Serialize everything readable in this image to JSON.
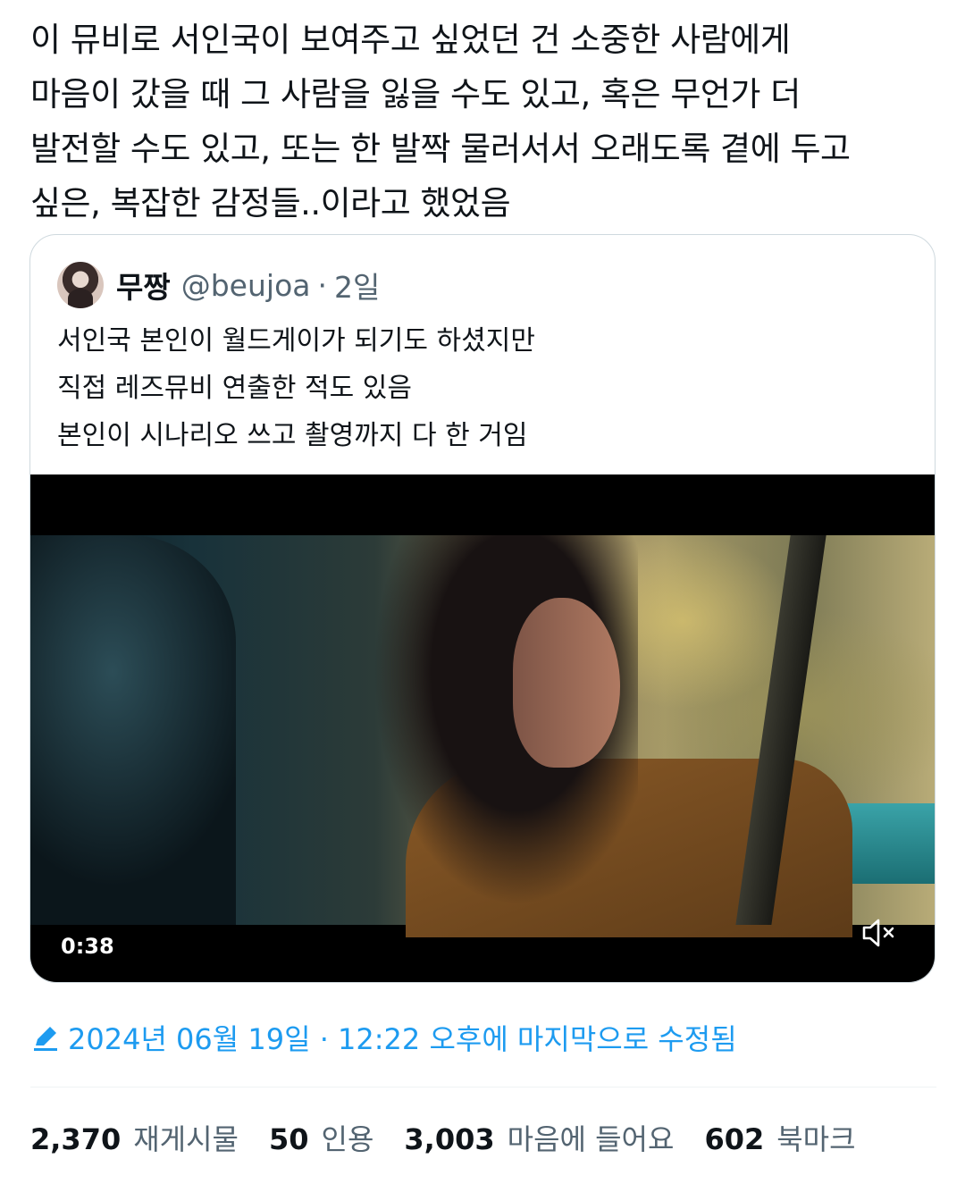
{
  "tweet": {
    "text_lines": [
      "이 뮤비로 서인국이 보여주고 싶었던 건 소중한 사람에게",
      "마음이 갔을 때 그 사람을 잃을 수도 있고, 혹은 무언가 더",
      "발전할 수도 있고, 또는 한 발짝 물러서서 오래도록 곁에 두고",
      "싶은, 복잡한 감정들..이라고 했었음"
    ]
  },
  "quote": {
    "name": "무짱",
    "handle": "@beujoa",
    "separator": "·",
    "time": "2일",
    "text_lines": [
      "서인국 본인이 월드게이가 되기도 하셨지만",
      "직접 레즈뮤비 연출한 적도 있음",
      "본인이 시나리오 쓰고 촬영까지 다 한 거임"
    ],
    "video": {
      "duration": "0:38",
      "mute_icon": "speaker-muted-icon"
    }
  },
  "edited": {
    "icon": "pencil-icon",
    "text": "2024년 06월 19일 · 12:22 오후에 마지막으로 수정됨"
  },
  "stats": {
    "retweets": {
      "num": "2,370",
      "label": "재게시물"
    },
    "quotes": {
      "num": "50",
      "label": "인용"
    },
    "likes": {
      "num": "3,003",
      "label": "마음에 들어요"
    },
    "bookmarks": {
      "num": "602",
      "label": "북마크"
    }
  },
  "colors": {
    "accent": "#1d9bf0",
    "text": "#0f1419",
    "secondary": "#536471",
    "border": "#cfd9de"
  }
}
